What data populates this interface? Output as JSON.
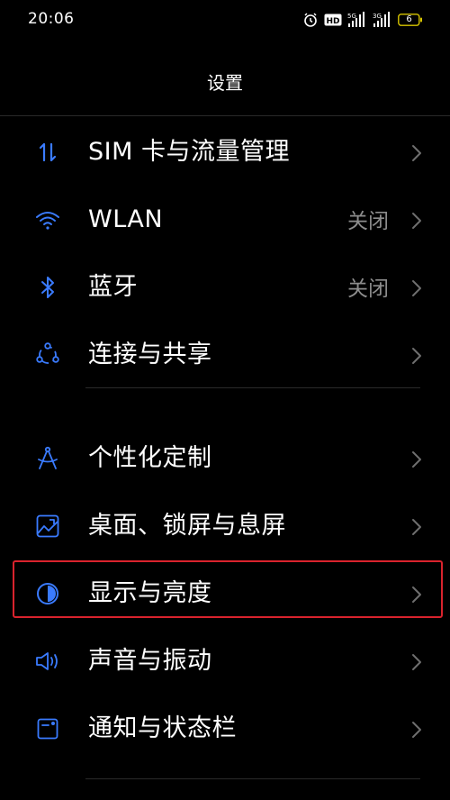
{
  "status_bar": {
    "time": "20:06",
    "battery_level": "6",
    "icons": [
      "alarm-icon",
      "hd-icon",
      "signal-5g-icon",
      "signal-3g-icon",
      "battery-icon"
    ]
  },
  "header": {
    "title": "设置"
  },
  "colors": {
    "background": "#000000",
    "icon_accent": "#3a7bff",
    "secondary_text": "#8c8c8c",
    "highlight_border": "#d9232d"
  },
  "settings": {
    "group1": [
      {
        "label": "SIM 卡与流量管理",
        "value": "",
        "icon": "data-transfer-icon"
      },
      {
        "label": "WLAN",
        "value": "关闭",
        "icon": "wifi-icon"
      },
      {
        "label": "蓝牙",
        "value": "关闭",
        "icon": "bluetooth-icon"
      },
      {
        "label": "连接与共享",
        "value": "",
        "icon": "connection-share-icon"
      }
    ],
    "group2": [
      {
        "label": "个性化定制",
        "value": "",
        "icon": "personalize-icon"
      },
      {
        "label": "桌面、锁屏与息屏",
        "value": "",
        "icon": "wallpaper-icon"
      },
      {
        "label": "显示与亮度",
        "value": "",
        "icon": "display-brightness-icon",
        "highlighted": true
      },
      {
        "label": "声音与振动",
        "value": "",
        "icon": "speaker-icon"
      },
      {
        "label": "通知与状态栏",
        "value": "",
        "icon": "notification-icon"
      }
    ]
  }
}
